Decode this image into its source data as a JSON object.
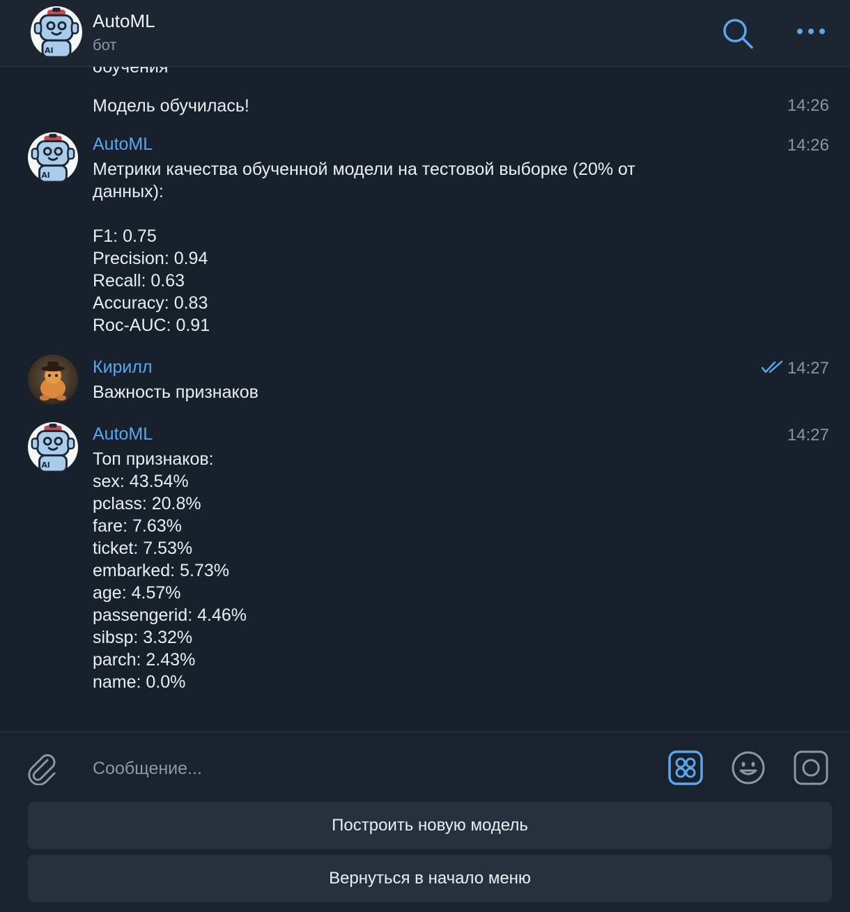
{
  "header": {
    "title": "AutoML",
    "subtitle": "бот",
    "icons": [
      "bot-avatar",
      "search-icon",
      "more-icon"
    ]
  },
  "chat": {
    "cut_off_text": "обучения",
    "messages": [
      {
        "text": "Модель обучилась!",
        "time": "14:26"
      },
      {
        "sender": "AutoML",
        "time": "14:26",
        "lines": [
          "Метрики качества обученной модели на тестовой выборке (20% от",
          "данных):",
          "",
          "F1: 0.75",
          "Precision: 0.94",
          "Recall: 0.63",
          "Accuracy: 0.83",
          "Roc-AUC: 0.91"
        ]
      },
      {
        "sender": "Кирилл",
        "text": "Важность признаков",
        "time": "14:27",
        "status": "read"
      },
      {
        "sender": "AutoML",
        "time": "14:27",
        "lines": [
          "Топ признаков:",
          "sex: 43.54%",
          "pclass: 20.8%",
          "fare: 7.63%",
          "ticket: 7.53%",
          "embarked: 5.73%",
          "age: 4.57%",
          "passengerid: 4.46%",
          "sibsp: 3.32%",
          "parch: 2.43%",
          "name: 0.0%"
        ]
      }
    ]
  },
  "composer": {
    "placeholder": "Сообщение...",
    "icons": [
      "attach-icon",
      "bot-keyboard-icon",
      "emoji-icon",
      "camera-icon"
    ]
  },
  "keyboard": {
    "buttons": [
      "Построить новую модель",
      "Вернуться в начало меню"
    ]
  },
  "colors": {
    "background": "#18202b",
    "accent": "#5aa6ef",
    "text": "#e9eef3",
    "secondary": "#8a97a6"
  }
}
